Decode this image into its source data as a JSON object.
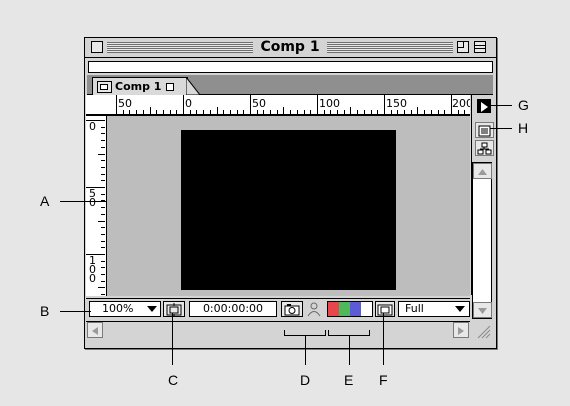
{
  "window": {
    "title": "Comp 1",
    "tab_label": "Comp 1"
  },
  "ruler": {
    "horizontal_labels": [
      "50",
      "0",
      "50",
      "100",
      "150",
      "200"
    ],
    "vertical_labels": [
      "0",
      "5\n0",
      "1\n0\n0"
    ]
  },
  "bottom": {
    "zoom_value": "100%",
    "timecode": "0:00:00:00",
    "resolution": "Full"
  },
  "callouts": {
    "a": "A",
    "b": "B",
    "c": "C",
    "d": "D",
    "e": "E",
    "f": "F",
    "g": "G",
    "h": "H"
  },
  "colors": {
    "channel_red": "#e8464b",
    "channel_green": "#4fb85a",
    "channel_blue": "#5b5bd6",
    "channel_white": "#ffffff"
  }
}
